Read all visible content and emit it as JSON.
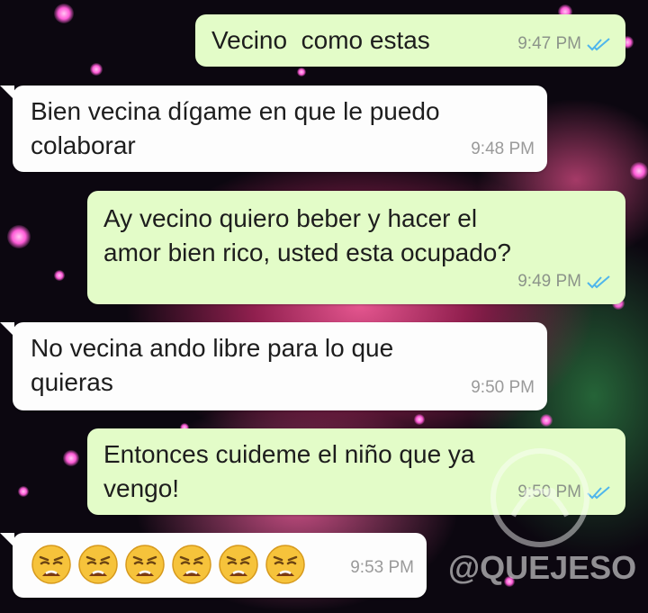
{
  "conversation": {
    "messages": [
      {
        "direction": "outgoing",
        "text": "Vecino  como estas",
        "time": "9:47 PM",
        "status": "read"
      },
      {
        "direction": "incoming",
        "text_line1": "Bien vecina dígame en que le puedo",
        "text_line2": "colaborar",
        "time": "9:48 PM"
      },
      {
        "direction": "outgoing",
        "text_line1": "Ay vecino quiero beber y hacer el",
        "text_line2": "amor bien rico, usted esta ocupado?",
        "time": "9:49 PM",
        "status": "read"
      },
      {
        "direction": "incoming",
        "text_line1": "No vecina ando libre para lo que",
        "text_line2": "quieras",
        "time": "9:50 PM"
      },
      {
        "direction": "outgoing",
        "text_line1": "Entonces cuideme el niño que ya",
        "text_line2": "vengo!",
        "time": "9:50 PM",
        "status": "read"
      },
      {
        "direction": "incoming",
        "emoji": "weary-face",
        "emoji_count": 6,
        "time": "9:53 PM"
      }
    ]
  },
  "colors": {
    "outgoing_bubble": "#e3fcc8",
    "incoming_bubble": "#fdfdfd",
    "read_ticks": "#4fb6ec"
  },
  "watermark": {
    "text": "@QUEJESO"
  }
}
